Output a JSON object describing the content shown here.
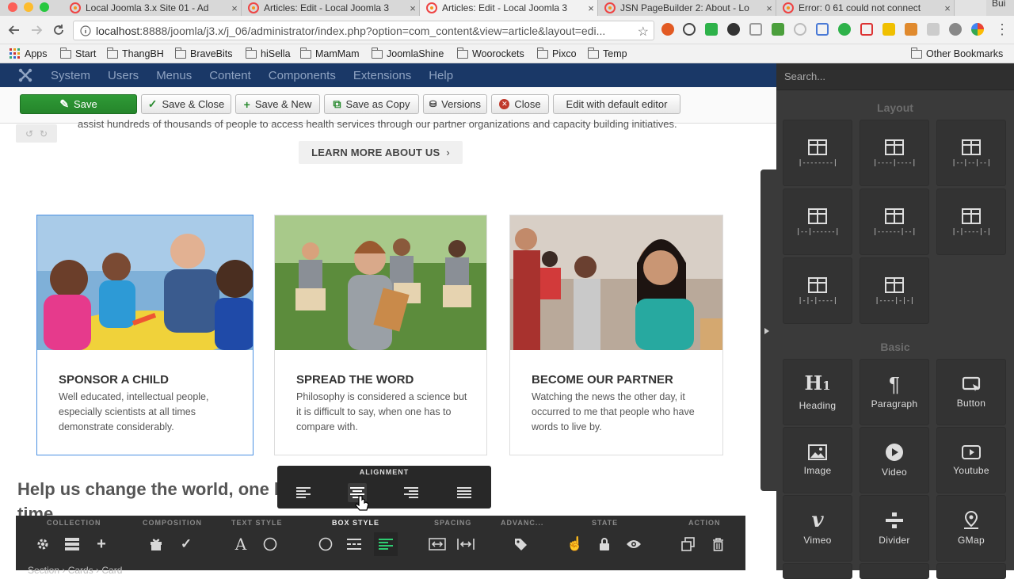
{
  "browser": {
    "tabs": [
      {
        "title": "Local Joomla 3.x Site 01 - Ad",
        "favicon": "joomla"
      },
      {
        "title": "Articles: Edit - Local Joomla 3",
        "favicon": "joomla"
      },
      {
        "title": "Articles: Edit - Local Joomla 3",
        "favicon": "joomla",
        "active": true
      },
      {
        "title": "JSN PageBuilder 2: About - Lo",
        "favicon": "joomla"
      },
      {
        "title": "Error: 0 61 could not connect",
        "favicon": "joomla"
      }
    ],
    "tab_close": "×",
    "corner_label": "Bui",
    "url_host": "localhost",
    "url_rest": ":8888/joomla/j3.x/j_06/administrator/index.php?option=com_content&view=article&layout=edi...",
    "bookmarks": [
      "Apps",
      "Start",
      "ThangBH",
      "BraveBits",
      "hiSella",
      "MamMam",
      "JoomlaShine",
      "Woorockets",
      "Pixco",
      "Temp"
    ],
    "other_bookmarks": "Other Bookmarks"
  },
  "joomla": {
    "menu": [
      "System",
      "Users",
      "Menus",
      "Content",
      "Components",
      "Extensions",
      "Help"
    ],
    "toolbar": {
      "save": "Save",
      "save_close": "Save & Close",
      "save_new": "Save & New",
      "save_copy": "Save as Copy",
      "versions": "Versions",
      "close": "Close",
      "default_editor": "Edit with default editor"
    }
  },
  "page": {
    "intro_line": "assist hundreds of thousands of people to access health services through our partner organizations and capacity building initiatives.",
    "learn_more": "LEARN MORE ABOUT US",
    "cards": [
      {
        "title": "SPONSOR A CHILD",
        "text": "Well educated, intellectual people, especially scientists at all times demonstrate considerably."
      },
      {
        "title": "SPREAD THE WORD",
        "text": "Philosophy is considered a science but it is difficult to say, when one has to compare with."
      },
      {
        "title": "BECOME OUR PARTNER",
        "text": "Watching the news the other day, it occurred to me that people who have words to live by."
      }
    ],
    "heading_line1": "Help us change the world, one l",
    "heading_line2": "time"
  },
  "alignment_popup": {
    "label": "ALIGNMENT",
    "options": [
      "align-left",
      "align-center",
      "align-right",
      "align-justify"
    ],
    "selected": "align-center"
  },
  "editor_toolbar": {
    "groups": [
      "COLLECTION",
      "COMPOSITION",
      "TEXT STYLE",
      "BOX STYLE",
      "SPACING",
      "ADVANC...",
      "STATE",
      "ACTION"
    ],
    "active_group": "BOX STYLE",
    "breadcrumb": "Section › Cards › Card",
    "accent": "#2ecc71"
  },
  "sidebar": {
    "search_placeholder": "Search...",
    "layout_label": "Layout",
    "layouts": [
      "|--------|",
      "|----|----|",
      "|--|--|--|",
      "|--|------|",
      "|------|--|",
      "|-|----|-|",
      "|-|-|----|",
      "|----|-|-|"
    ],
    "basic_label": "Basic",
    "elements": [
      {
        "label": "Heading",
        "icon": "heading-icon"
      },
      {
        "label": "Paragraph",
        "icon": "paragraph-icon"
      },
      {
        "label": "Button",
        "icon": "button-icon"
      },
      {
        "label": "Image",
        "icon": "image-icon"
      },
      {
        "label": "Video",
        "icon": "video-icon"
      },
      {
        "label": "Youtube",
        "icon": "youtube-icon"
      },
      {
        "label": "Vimeo",
        "icon": "vimeo-icon"
      },
      {
        "label": "Divider",
        "icon": "divider-icon"
      },
      {
        "label": "GMap",
        "icon": "gmap-icon"
      }
    ]
  }
}
